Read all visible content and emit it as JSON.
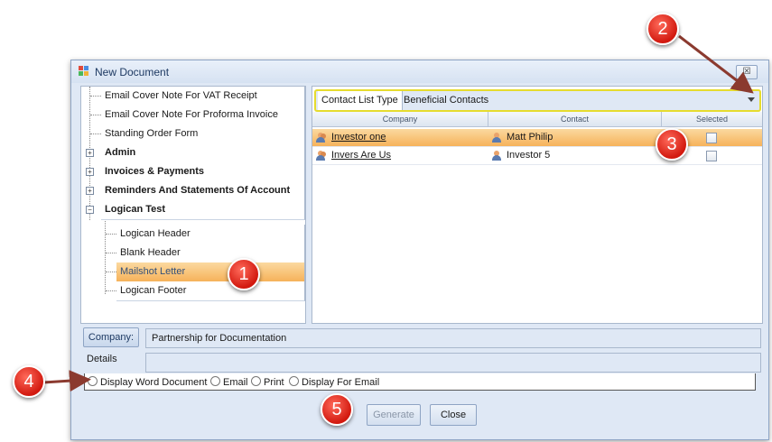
{
  "window": {
    "title": "New Document",
    "close_glyph": "☒"
  },
  "tree": {
    "items": [
      {
        "label": "Email Cover Note For VAT Receipt",
        "bold": false
      },
      {
        "label": "Email Cover Note For Proforma Invoice",
        "bold": false
      },
      {
        "label": "Standing Order Form",
        "bold": false
      },
      {
        "label": "Admin",
        "bold": true,
        "expander": "+"
      },
      {
        "label": "Invoices & Payments",
        "bold": true,
        "expander": "+"
      },
      {
        "label": "Reminders And Statements Of Account",
        "bold": true,
        "expander": "+"
      },
      {
        "label": "Logican Test",
        "bold": true,
        "expander": "−"
      }
    ],
    "children": [
      {
        "label": "Logican Header"
      },
      {
        "label": "Blank Header"
      },
      {
        "label": "Mailshot Letter",
        "selected": true
      },
      {
        "label": "Logican Footer"
      }
    ]
  },
  "contact_list": {
    "label": "Contact List Type",
    "value": "Beneficial Contacts"
  },
  "grid": {
    "headers": {
      "company": "Company",
      "contact": "Contact",
      "selected": "Selected"
    },
    "rows": [
      {
        "company": "Investor one",
        "contact": "Matt Philip",
        "selected": false
      },
      {
        "company": "Invers Are Us",
        "contact": "Investor 5",
        "selected": false
      }
    ]
  },
  "company_button": "Company:",
  "company_value": "Partnership for Documentation",
  "details_label": "Details",
  "output_options": [
    "Display Word Document",
    "Email",
    "Print",
    "Display For Email"
  ],
  "buttons": {
    "generate": "Generate",
    "close": "Close"
  },
  "callouts": [
    "1",
    "2",
    "3",
    "4",
    "5"
  ],
  "colors": {
    "callout": "#d2190f",
    "highlight": "#e6dc2e",
    "selection": "#f6b25a",
    "window_bg": "#dfe8f5"
  }
}
